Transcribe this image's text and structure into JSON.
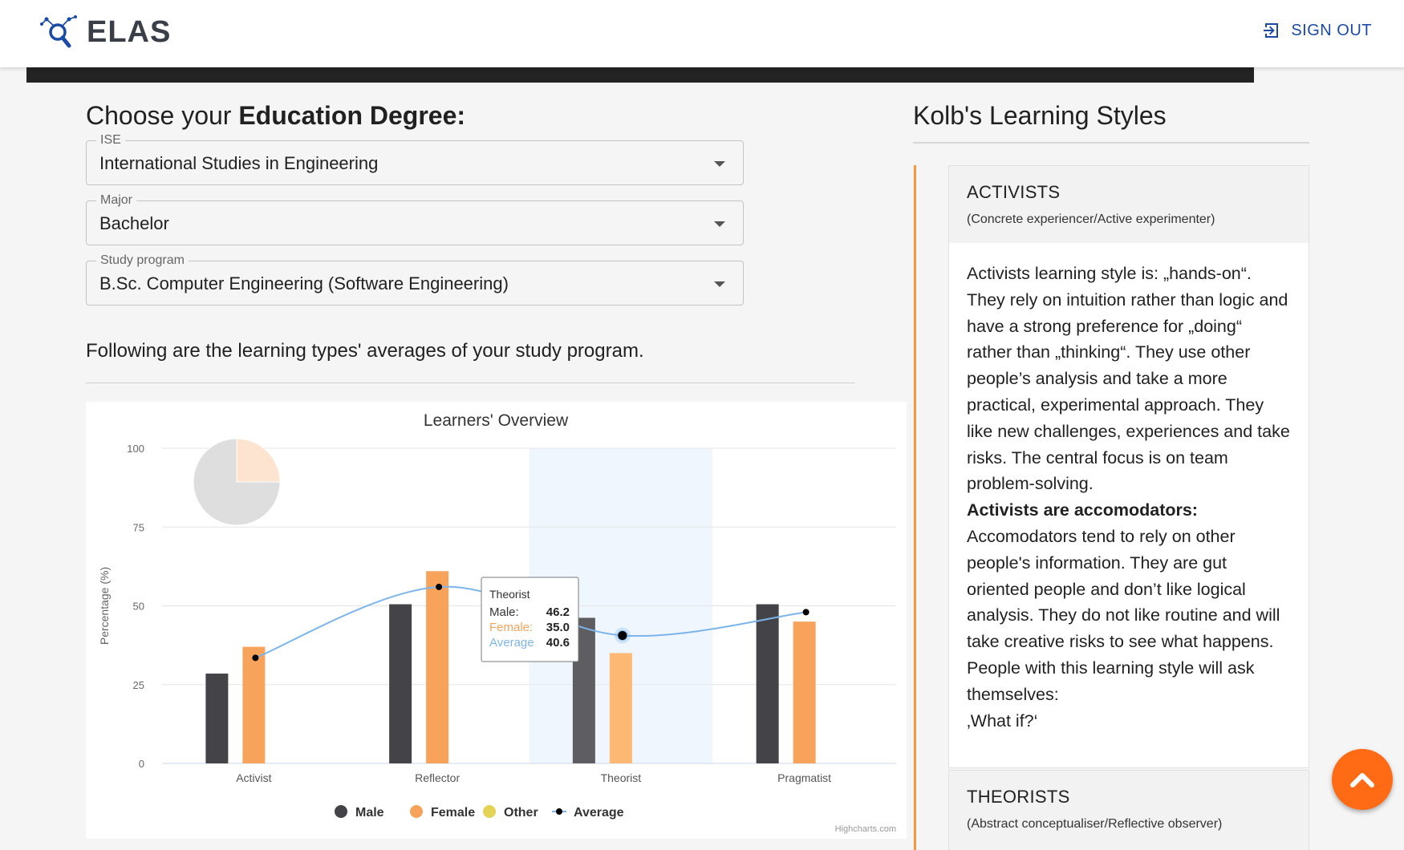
{
  "app": {
    "logo_text": "ELAS",
    "logo_icon": "magnifier-network-icon",
    "signout_label": "SIGN OUT"
  },
  "degree": {
    "heading_prefix": "Choose your ",
    "heading_bold": "Education Degree:",
    "selects": [
      {
        "label": "ISE",
        "value": "International Studies in Engineering"
      },
      {
        "label": "Major",
        "value": "Bachelor"
      },
      {
        "label": "Study program",
        "value": "B.Sc. Computer Engineering (Software Engineering)"
      }
    ],
    "subtext": "Following are the learning types' averages of your study program."
  },
  "chart_data": {
    "type": "bar",
    "title": "Learners' Overview",
    "ylabel": "Percentage (%)",
    "ylim": [
      0,
      100
    ],
    "yticks": [
      0,
      25,
      50,
      75,
      100
    ],
    "categories": [
      "Activist",
      "Reflector",
      "Theorist",
      "Pragmatist"
    ],
    "series": [
      {
        "name": "Male",
        "type": "bar",
        "color": "#434348",
        "values": [
          28.5,
          50.5,
          46.2,
          50.5
        ]
      },
      {
        "name": "Female",
        "type": "bar",
        "color": "#f7a35c",
        "values": [
          37,
          61,
          35.0,
          45
        ]
      },
      {
        "name": "Other",
        "type": "bar",
        "color": "#e4d354",
        "values": [
          0,
          0,
          0,
          0
        ]
      },
      {
        "name": "Average",
        "type": "spline",
        "color": "#7cb5ec",
        "values": [
          33.5,
          56,
          40.6,
          48
        ]
      }
    ],
    "pie": {
      "slices": [
        {
          "name": "Female",
          "value": 25,
          "color": "#fde4d0"
        },
        {
          "name": "Male",
          "value": 75,
          "color": "#dedede"
        }
      ]
    },
    "highlighted_category": "Theorist",
    "tooltip": {
      "title": "Theorist",
      "rows": [
        {
          "label": "Male:",
          "value": "46.2",
          "color": "#333333"
        },
        {
          "label": "Female:",
          "value": "35.0",
          "color": "#f7a35c"
        },
        {
          "label": "Average",
          "value": "40.6",
          "color": "#7cb5ec"
        }
      ]
    },
    "credits": "Highcharts.com",
    "legend_position": "bottom-center",
    "grid": true
  },
  "kolb": {
    "title": "Kolb's Learning Styles",
    "cards": [
      {
        "title": "ACTIVISTS",
        "subtitle": "(Concrete experiencer/Active experimenter)",
        "paragraph1": "Activists learning style is: „hands-on“. They rely on intuition rather than logic and have a strong preference for „doing“ rather than „thinking“. They use other people’s analysis and take a more practical, experimental approach. They like new challenges, experiences and take risks. The central focus is on team problem-solving.",
        "bold": "Activists are accomodators:",
        "paragraph2": "Accomodators tend to rely on other people's information. They are gut oriented people and don’t like logical analysis. They do not like routine and will take creative risks to see what happens. People with this learning style will ask themselves:",
        "quote": "‚What if?‘"
      },
      {
        "title": "THEORISTS",
        "subtitle": "(Abstract conceptualiser/Reflective observer)"
      }
    ]
  },
  "fab_icon": "chevron-up-icon"
}
